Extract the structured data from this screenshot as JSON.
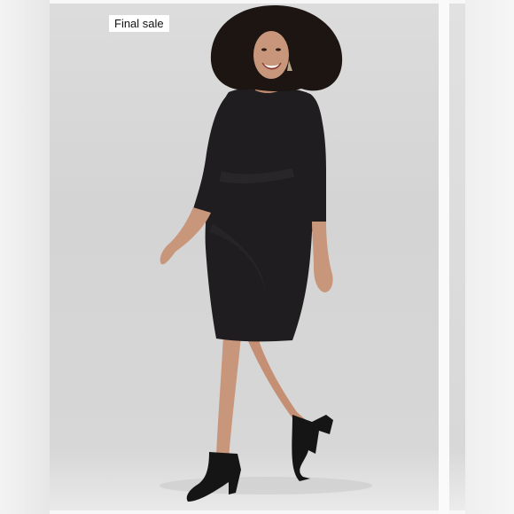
{
  "listing": {
    "badge_label": "Final sale"
  },
  "photo": {
    "subject_icon": "model-in-black-dress-photo",
    "backdrop_color": "#d7d7d7",
    "dress_color": "#1f1d1f",
    "skin_color": "#c8967a",
    "hair_color": "#1c1512"
  }
}
